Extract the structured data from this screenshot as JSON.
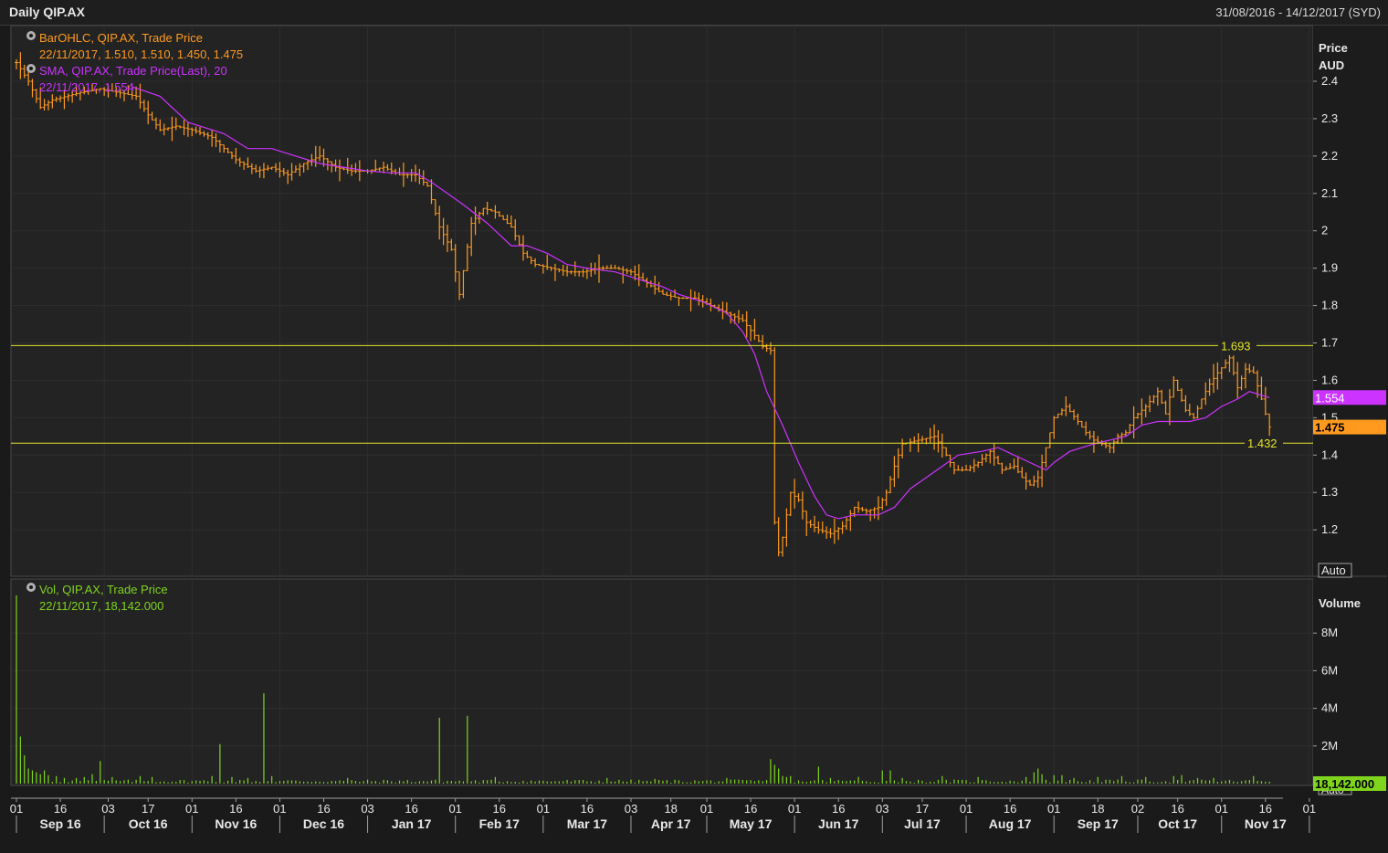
{
  "header": {
    "title": "Daily QIP.AX",
    "date_range": "31/08/2016 - 14/12/2017 (SYD)"
  },
  "price_panel": {
    "axis_title_1": "Price",
    "axis_title_2": "AUD",
    "auto_button": "Auto",
    "legend": [
      {
        "name": "BarOHLC, QIP.AX, Trade Price",
        "values": "22/11/2017, 1.510, 1.510, 1.450, 1.475",
        "color": "#ff9a1f"
      },
      {
        "name": "SMA, QIP.AX, Trade Price(Last),  20",
        "values": "22/11/2017, 1.554",
        "color": "#cc33ff"
      }
    ],
    "last_price_tag": "1.475",
    "last_sma_tag": "1.554",
    "hlines": [
      {
        "value": 1.693,
        "label": "1.693"
      },
      {
        "value": 1.432,
        "label": "1.432"
      }
    ]
  },
  "volume_panel": {
    "axis_title": "Volume",
    "auto_button": "Auto",
    "legend": {
      "name": "Vol, QIP.AX, Trade Price",
      "values": "22/11/2017, 18,142.000",
      "color": "#7fd41e"
    },
    "last_volume_tag": "18,142.000"
  },
  "x_axis": {
    "day_ticks": [
      {
        "label": "01",
        "pos": 0
      },
      {
        "label": "16",
        "pos": 11
      },
      {
        "label": "03",
        "pos": 23
      },
      {
        "label": "17",
        "pos": 33
      },
      {
        "label": "01",
        "pos": 44
      },
      {
        "label": "16",
        "pos": 55
      },
      {
        "label": "01",
        "pos": 66
      },
      {
        "label": "16",
        "pos": 77
      },
      {
        "label": "03",
        "pos": 88
      },
      {
        "label": "16",
        "pos": 99
      },
      {
        "label": "01",
        "pos": 110
      },
      {
        "label": "16",
        "pos": 121
      },
      {
        "label": "01",
        "pos": 132
      },
      {
        "label": "16",
        "pos": 143
      },
      {
        "label": "03",
        "pos": 154
      },
      {
        "label": "18",
        "pos": 164
      },
      {
        "label": "01",
        "pos": 173
      },
      {
        "label": "16",
        "pos": 184
      },
      {
        "label": "01",
        "pos": 195
      },
      {
        "label": "16",
        "pos": 206
      },
      {
        "label": "03",
        "pos": 217
      },
      {
        "label": "17",
        "pos": 227
      },
      {
        "label": "01",
        "pos": 238
      },
      {
        "label": "16",
        "pos": 249
      },
      {
        "label": "01",
        "pos": 260
      },
      {
        "label": "18",
        "pos": 271
      },
      {
        "label": "02",
        "pos": 281
      },
      {
        "label": "16",
        "pos": 291
      },
      {
        "label": "01",
        "pos": 302
      },
      {
        "label": "16",
        "pos": 313
      },
      {
        "label": "01",
        "pos": 324
      }
    ],
    "month_labels": [
      {
        "label": "Sep 16",
        "pos": 11
      },
      {
        "label": "Oct 16",
        "pos": 33
      },
      {
        "label": "Nov 16",
        "pos": 55
      },
      {
        "label": "Dec 16",
        "pos": 77
      },
      {
        "label": "Jan 17",
        "pos": 99
      },
      {
        "label": "Feb 17",
        "pos": 121
      },
      {
        "label": "Mar 17",
        "pos": 143
      },
      {
        "label": "Apr 17",
        "pos": 164
      },
      {
        "label": "May 17",
        "pos": 184
      },
      {
        "label": "Jun 17",
        "pos": 206
      },
      {
        "label": "Jul 17",
        "pos": 227
      },
      {
        "label": "Aug 17",
        "pos": 249
      },
      {
        "label": "Sep 17",
        "pos": 271
      },
      {
        "label": "Oct 17",
        "pos": 291
      },
      {
        "label": "Nov 17",
        "pos": 313
      }
    ],
    "month_separators": [
      22,
      44,
      66,
      88,
      110,
      132,
      154,
      173,
      195,
      217,
      238,
      260,
      281,
      302,
      324
    ]
  },
  "chart_data": {
    "type": "bar",
    "price_series": {
      "name": "BarOHLC, QIP.AX, Trade Price",
      "ylim": [
        1.1,
        2.45
      ],
      "yticks": [
        {
          "value": 2.4,
          "label": "2.4"
        },
        {
          "value": 2.3,
          "label": "2.3"
        },
        {
          "value": 2.2,
          "label": "2.2"
        },
        {
          "value": 2.1,
          "label": "2.1"
        },
        {
          "value": 2.0,
          "label": "2"
        },
        {
          "value": 1.9,
          "label": "1.9"
        },
        {
          "value": 1.8,
          "label": "1.8"
        },
        {
          "value": 1.7,
          "label": "1.7"
        },
        {
          "value": 1.6,
          "label": "1.6"
        },
        {
          "value": 1.5,
          "label": "1.5"
        },
        {
          "value": 1.4,
          "label": "1.4"
        },
        {
          "value": 1.3,
          "label": "1.3"
        },
        {
          "value": 1.2,
          "label": "1.2"
        }
      ],
      "close_anchors": [
        [
          0,
          2.45
        ],
        [
          3,
          2.4
        ],
        [
          6,
          2.33
        ],
        [
          9,
          2.35
        ],
        [
          16,
          2.37
        ],
        [
          21,
          2.38
        ],
        [
          30,
          2.36
        ],
        [
          33,
          2.31
        ],
        [
          36,
          2.27
        ],
        [
          40,
          2.28
        ],
        [
          44,
          2.27
        ],
        [
          49,
          2.25
        ],
        [
          55,
          2.19
        ],
        [
          60,
          2.16
        ],
        [
          64,
          2.17
        ],
        [
          68,
          2.15
        ],
        [
          72,
          2.18
        ],
        [
          76,
          2.2
        ],
        [
          80,
          2.17
        ],
        [
          84,
          2.16
        ],
        [
          88,
          2.16
        ],
        [
          92,
          2.17
        ],
        [
          96,
          2.15
        ],
        [
          100,
          2.15
        ],
        [
          103,
          2.12
        ],
        [
          106,
          2.01
        ],
        [
          109,
          1.95
        ],
        [
          111,
          1.83
        ],
        [
          114,
          2.02
        ],
        [
          117,
          2.06
        ],
        [
          120,
          2.05
        ],
        [
          124,
          2.01
        ],
        [
          127,
          1.94
        ],
        [
          130,
          1.91
        ],
        [
          134,
          1.9
        ],
        [
          138,
          1.89
        ],
        [
          142,
          1.89
        ],
        [
          146,
          1.9
        ],
        [
          150,
          1.9
        ],
        [
          154,
          1.89
        ],
        [
          158,
          1.86
        ],
        [
          162,
          1.83
        ],
        [
          166,
          1.82
        ],
        [
          170,
          1.82
        ],
        [
          174,
          1.8
        ],
        [
          178,
          1.78
        ],
        [
          182,
          1.76
        ],
        [
          185,
          1.72
        ],
        [
          187,
          1.69
        ],
        [
          189,
          1.68
        ],
        [
          190,
          1.22
        ],
        [
          191,
          1.14
        ],
        [
          192,
          1.18
        ],
        [
          194,
          1.3
        ],
        [
          196,
          1.28
        ],
        [
          198,
          1.22
        ],
        [
          201,
          1.2
        ],
        [
          204,
          1.19
        ],
        [
          207,
          1.21
        ],
        [
          210,
          1.26
        ],
        [
          213,
          1.25
        ],
        [
          216,
          1.26
        ],
        [
          218,
          1.3
        ],
        [
          220,
          1.37
        ],
        [
          222,
          1.43
        ],
        [
          226,
          1.44
        ],
        [
          230,
          1.45
        ],
        [
          232,
          1.42
        ],
        [
          235,
          1.36
        ],
        [
          238,
          1.36
        ],
        [
          241,
          1.38
        ],
        [
          244,
          1.41
        ],
        [
          247,
          1.36
        ],
        [
          250,
          1.37
        ],
        [
          252,
          1.34
        ],
        [
          254,
          1.32
        ],
        [
          256,
          1.34
        ],
        [
          258,
          1.42
        ],
        [
          260,
          1.5
        ],
        [
          263,
          1.53
        ],
        [
          266,
          1.49
        ],
        [
          268,
          1.46
        ],
        [
          270,
          1.44
        ],
        [
          272,
          1.43
        ],
        [
          274,
          1.42
        ],
        [
          276,
          1.45
        ],
        [
          278,
          1.46
        ],
        [
          280,
          1.5
        ],
        [
          283,
          1.53
        ],
        [
          286,
          1.57
        ],
        [
          288,
          1.51
        ],
        [
          290,
          1.6
        ],
        [
          293,
          1.52
        ],
        [
          295,
          1.5
        ],
        [
          297,
          1.55
        ],
        [
          299,
          1.59
        ],
        [
          301,
          1.62
        ],
        [
          304,
          1.66
        ],
        [
          306,
          1.58
        ],
        [
          308,
          1.63
        ],
        [
          310,
          1.62
        ],
        [
          312,
          1.55
        ],
        [
          313,
          1.51
        ],
        [
          314,
          1.475
        ]
      ],
      "last": {
        "date": "22/11/2017",
        "open": 1.51,
        "high": 1.51,
        "low": 1.45,
        "close": 1.475
      }
    },
    "sma_series": {
      "name": "SMA, QIP.AX, Trade Price(Last), 20",
      "points": [
        [
          29,
          2.385
        ],
        [
          36,
          2.36
        ],
        [
          43,
          2.29
        ],
        [
          52,
          2.26
        ],
        [
          58,
          2.22
        ],
        [
          64,
          2.22
        ],
        [
          70,
          2.2
        ],
        [
          76,
          2.18
        ],
        [
          82,
          2.17
        ],
        [
          88,
          2.16
        ],
        [
          94,
          2.155
        ],
        [
          100,
          2.155
        ],
        [
          104,
          2.13
        ],
        [
          108,
          2.1
        ],
        [
          112,
          2.07
        ],
        [
          118,
          2.02
        ],
        [
          124,
          1.96
        ],
        [
          128,
          1.96
        ],
        [
          133,
          1.94
        ],
        [
          138,
          1.91
        ],
        [
          143,
          1.9
        ],
        [
          150,
          1.89
        ],
        [
          156,
          1.87
        ],
        [
          162,
          1.85
        ],
        [
          166,
          1.83
        ],
        [
          172,
          1.81
        ],
        [
          178,
          1.78
        ],
        [
          182,
          1.73
        ],
        [
          185,
          1.67
        ],
        [
          188,
          1.57
        ],
        [
          192,
          1.48
        ],
        [
          196,
          1.38
        ],
        [
          200,
          1.29
        ],
        [
          203,
          1.24
        ],
        [
          206,
          1.23
        ],
        [
          210,
          1.24
        ],
        [
          216,
          1.24
        ],
        [
          220,
          1.26
        ],
        [
          224,
          1.31
        ],
        [
          228,
          1.34
        ],
        [
          232,
          1.37
        ],
        [
          236,
          1.4
        ],
        [
          242,
          1.41
        ],
        [
          246,
          1.42
        ],
        [
          250,
          1.4
        ],
        [
          254,
          1.38
        ],
        [
          258,
          1.36
        ],
        [
          260,
          1.38
        ],
        [
          264,
          1.41
        ],
        [
          270,
          1.43
        ],
        [
          274,
          1.44
        ],
        [
          278,
          1.45
        ],
        [
          282,
          1.48
        ],
        [
          286,
          1.49
        ],
        [
          290,
          1.49
        ],
        [
          294,
          1.49
        ],
        [
          298,
          1.5
        ],
        [
          302,
          1.53
        ],
        [
          306,
          1.55
        ],
        [
          309,
          1.57
        ],
        [
          312,
          1.56
        ],
        [
          314,
          1.554
        ]
      ],
      "last": {
        "date": "22/11/2017",
        "value": 1.554
      }
    },
    "volume_series": {
      "name": "Vol, QIP.AX, Trade Price",
      "ylim": [
        0,
        10000000
      ],
      "yticks": [
        {
          "value": 2000000,
          "label": "2M"
        },
        {
          "value": 4000000,
          "label": "4M"
        },
        {
          "value": 6000000,
          "label": "6M"
        },
        {
          "value": 8000000,
          "label": "8M"
        }
      ],
      "baseline": 120000,
      "spikes": [
        [
          0,
          10000000
        ],
        [
          1,
          2500000
        ],
        [
          2,
          1500000
        ],
        [
          3,
          800000
        ],
        [
          4,
          700000
        ],
        [
          5,
          600000
        ],
        [
          6,
          500000
        ],
        [
          7,
          700000
        ],
        [
          8,
          450000
        ],
        [
          10,
          400000
        ],
        [
          12,
          300000
        ],
        [
          15,
          300000
        ],
        [
          17,
          350000
        ],
        [
          19,
          500000
        ],
        [
          21,
          1200000
        ],
        [
          24,
          350000
        ],
        [
          31,
          400000
        ],
        [
          34,
          350000
        ],
        [
          49,
          400000
        ],
        [
          51,
          2100000
        ],
        [
          54,
          350000
        ],
        [
          58,
          300000
        ],
        [
          62,
          4800000
        ],
        [
          64,
          400000
        ],
        [
          83,
          300000
        ],
        [
          106,
          3500000
        ],
        [
          113,
          3600000
        ],
        [
          120,
          350000
        ],
        [
          148,
          300000
        ],
        [
          160,
          250000
        ],
        [
          178,
          300000
        ],
        [
          189,
          1300000
        ],
        [
          190,
          1000000
        ],
        [
          191,
          800000
        ],
        [
          192,
          400000
        ],
        [
          193,
          350000
        ],
        [
          194,
          400000
        ],
        [
          201,
          900000
        ],
        [
          204,
          300000
        ],
        [
          211,
          350000
        ],
        [
          217,
          700000
        ],
        [
          219,
          700000
        ],
        [
          222,
          300000
        ],
        [
          232,
          400000
        ],
        [
          241,
          350000
        ],
        [
          253,
          350000
        ],
        [
          255,
          600000
        ],
        [
          256,
          800000
        ],
        [
          257,
          500000
        ],
        [
          260,
          450000
        ],
        [
          262,
          450000
        ],
        [
          265,
          300000
        ],
        [
          271,
          350000
        ],
        [
          277,
          400000
        ],
        [
          283,
          350000
        ],
        [
          290,
          400000
        ],
        [
          292,
          450000
        ],
        [
          296,
          300000
        ],
        [
          300,
          300000
        ],
        [
          310,
          400000
        ]
      ],
      "last": {
        "date": "22/11/2017",
        "value": 18142
      }
    }
  }
}
